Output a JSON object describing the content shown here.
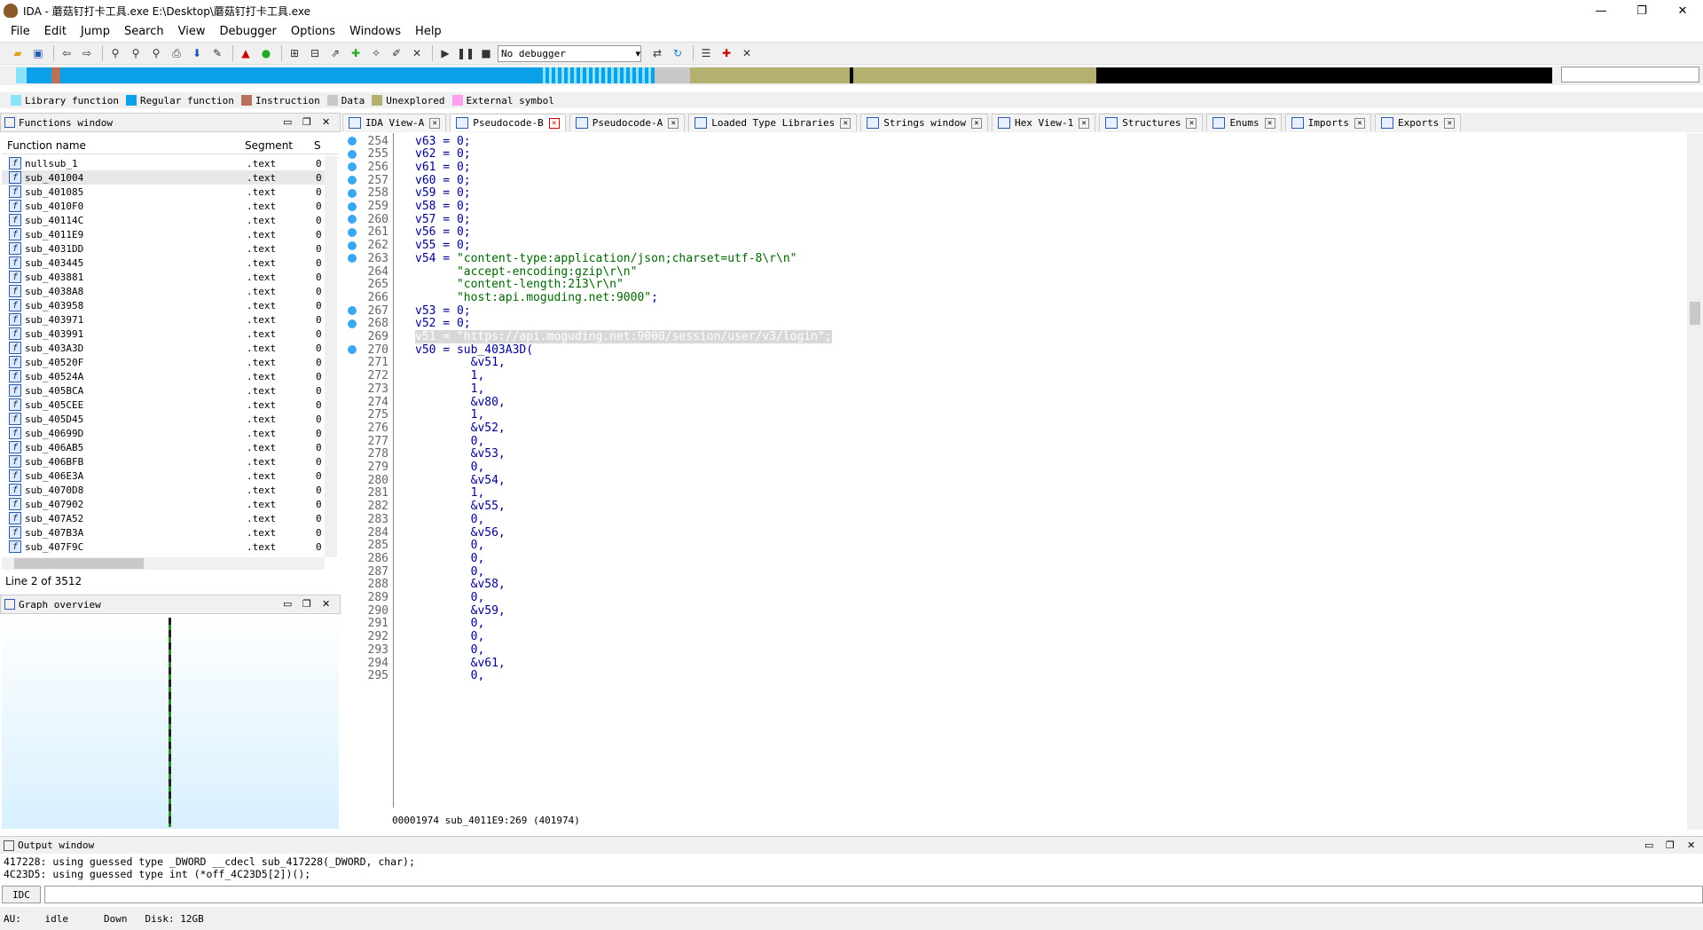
{
  "window": {
    "title": "IDA - 蘑菇钉打卡工具.exe E:\\Desktop\\蘑菇钉打卡工具.exe",
    "minimize": "—",
    "maximize": "❐",
    "close": "✕"
  },
  "menu": [
    "File",
    "Edit",
    "Jump",
    "Search",
    "View",
    "Debugger",
    "Options",
    "Windows",
    "Help"
  ],
  "toolbar": {
    "debugger": "No debugger"
  },
  "legend": [
    {
      "label": "Library function",
      "color": "#8ae3f7"
    },
    {
      "label": "Regular function",
      "color": "#0aa1e8"
    },
    {
      "label": "Instruction",
      "color": "#b8715a"
    },
    {
      "label": "Data",
      "color": "#c8c8c8"
    },
    {
      "label": "Unexplored",
      "color": "#b4b070"
    },
    {
      "label": "External symbol",
      "color": "#ff9ff0"
    }
  ],
  "functions_window": {
    "title": "Functions window",
    "col_name": "Function name",
    "col_segment": "Segment",
    "col_s": "S",
    "rows": [
      {
        "name": "nullsub_1",
        "seg": ".text",
        "s": "0"
      },
      {
        "name": "sub_401004",
        "seg": ".text",
        "s": "0"
      },
      {
        "name": "sub_401085",
        "seg": ".text",
        "s": "0"
      },
      {
        "name": "sub_4010F0",
        "seg": ".text",
        "s": "0"
      },
      {
        "name": "sub_40114C",
        "seg": ".text",
        "s": "0"
      },
      {
        "name": "sub_4011E9",
        "seg": ".text",
        "s": "0"
      },
      {
        "name": "sub_4031DD",
        "seg": ".text",
        "s": "0"
      },
      {
        "name": "sub_403445",
        "seg": ".text",
        "s": "0"
      },
      {
        "name": "sub_403881",
        "seg": ".text",
        "s": "0"
      },
      {
        "name": "sub_4038A8",
        "seg": ".text",
        "s": "0"
      },
      {
        "name": "sub_403958",
        "seg": ".text",
        "s": "0"
      },
      {
        "name": "sub_403971",
        "seg": ".text",
        "s": "0"
      },
      {
        "name": "sub_403991",
        "seg": ".text",
        "s": "0"
      },
      {
        "name": "sub_403A3D",
        "seg": ".text",
        "s": "0"
      },
      {
        "name": "sub_40520F",
        "seg": ".text",
        "s": "0"
      },
      {
        "name": "sub_40524A",
        "seg": ".text",
        "s": "0"
      },
      {
        "name": "sub_405BCA",
        "seg": ".text",
        "s": "0"
      },
      {
        "name": "sub_405CEE",
        "seg": ".text",
        "s": "0"
      },
      {
        "name": "sub_405D45",
        "seg": ".text",
        "s": "0"
      },
      {
        "name": "sub_40699D",
        "seg": ".text",
        "s": "0"
      },
      {
        "name": "sub_406AB5",
        "seg": ".text",
        "s": "0"
      },
      {
        "name": "sub_406BFB",
        "seg": ".text",
        "s": "0"
      },
      {
        "name": "sub_406E3A",
        "seg": ".text",
        "s": "0"
      },
      {
        "name": "sub_4070D8",
        "seg": ".text",
        "s": "0"
      },
      {
        "name": "sub_407902",
        "seg": ".text",
        "s": "0"
      },
      {
        "name": "sub_407A52",
        "seg": ".text",
        "s": "0"
      },
      {
        "name": "sub_407B3A",
        "seg": ".text",
        "s": "0"
      },
      {
        "name": "sub_407F9C",
        "seg": ".text",
        "s": "0"
      }
    ],
    "status": "Line 2 of 3512"
  },
  "graph_overview": {
    "title": "Graph overview"
  },
  "tabs": [
    {
      "label": "IDA View-A"
    },
    {
      "label": "Pseudocode-B",
      "active": true
    },
    {
      "label": "Pseudocode-A"
    },
    {
      "label": "Loaded Type Libraries"
    },
    {
      "label": "Strings window"
    },
    {
      "label": "Hex View-1"
    },
    {
      "label": "Structures"
    },
    {
      "label": "Enums"
    },
    {
      "label": "Imports"
    },
    {
      "label": "Exports"
    }
  ],
  "code": [
    {
      "ln": "254",
      "dot": true,
      "text": "v63 = 0;"
    },
    {
      "ln": "255",
      "dot": true,
      "text": "v62 = 0;"
    },
    {
      "ln": "256",
      "dot": true,
      "text": "v61 = 0;"
    },
    {
      "ln": "257",
      "dot": true,
      "text": "v60 = 0;"
    },
    {
      "ln": "258",
      "dot": true,
      "text": "v59 = 0;"
    },
    {
      "ln": "259",
      "dot": true,
      "text": "v58 = 0;"
    },
    {
      "ln": "260",
      "dot": true,
      "text": "v57 = 0;"
    },
    {
      "ln": "261",
      "dot": true,
      "text": "v56 = 0;"
    },
    {
      "ln": "262",
      "dot": true,
      "text": "v55 = 0;"
    },
    {
      "ln": "263",
      "dot": true,
      "text": "v54 = \"content-type:application/json;charset=utf-8\\r\\n\""
    },
    {
      "ln": "264",
      "dot": false,
      "text": "      \"accept-encoding:gzip\\r\\n\""
    },
    {
      "ln": "265",
      "dot": false,
      "text": "      \"content-length:213\\r\\n\""
    },
    {
      "ln": "266",
      "dot": false,
      "text": "      \"host:api.moguding.net:9000\";"
    },
    {
      "ln": "267",
      "dot": true,
      "text": "v53 = 0;"
    },
    {
      "ln": "268",
      "dot": true,
      "text": "v52 = 0;"
    },
    {
      "ln": "269",
      "dot": false,
      "hl": true,
      "text": "v51 = \"https://api.moguding.net:9000/session/user/v3/login\";"
    },
    {
      "ln": "270",
      "dot": true,
      "text": "v50 = sub_403A3D("
    },
    {
      "ln": "271",
      "dot": false,
      "text": "        &v51,"
    },
    {
      "ln": "272",
      "dot": false,
      "text": "        1,"
    },
    {
      "ln": "273",
      "dot": false,
      "text": "        1,"
    },
    {
      "ln": "274",
      "dot": false,
      "text": "        &v80,"
    },
    {
      "ln": "275",
      "dot": false,
      "text": "        1,"
    },
    {
      "ln": "276",
      "dot": false,
      "text": "        &v52,"
    },
    {
      "ln": "277",
      "dot": false,
      "text": "        0,"
    },
    {
      "ln": "278",
      "dot": false,
      "text": "        &v53,"
    },
    {
      "ln": "279",
      "dot": false,
      "text": "        0,"
    },
    {
      "ln": "280",
      "dot": false,
      "text": "        &v54,"
    },
    {
      "ln": "281",
      "dot": false,
      "text": "        1,"
    },
    {
      "ln": "282",
      "dot": false,
      "text": "        &v55,"
    },
    {
      "ln": "283",
      "dot": false,
      "text": "        0,"
    },
    {
      "ln": "284",
      "dot": false,
      "text": "        &v56,"
    },
    {
      "ln": "285",
      "dot": false,
      "text": "        0,"
    },
    {
      "ln": "286",
      "dot": false,
      "text": "        0,"
    },
    {
      "ln": "287",
      "dot": false,
      "text": "        0,"
    },
    {
      "ln": "288",
      "dot": false,
      "text": "        &v58,"
    },
    {
      "ln": "289",
      "dot": false,
      "text": "        0,"
    },
    {
      "ln": "290",
      "dot": false,
      "text": "        &v59,"
    },
    {
      "ln": "291",
      "dot": false,
      "text": "        0,"
    },
    {
      "ln": "292",
      "dot": false,
      "text": "        0,"
    },
    {
      "ln": "293",
      "dot": false,
      "text": "        0,"
    },
    {
      "ln": "294",
      "dot": false,
      "text": "        &v61,"
    },
    {
      "ln": "295",
      "dot": false,
      "text": "        0,"
    }
  ],
  "code_status": "00001974 sub_4011E9:269 (401974)",
  "output": {
    "title": "Output window",
    "lines": [
      "417228: using guessed type _DWORD __cdecl sub_417228(_DWORD, char);",
      "4C23D5: using guessed type int (*off_4C23D5[2])();"
    ],
    "idc_label": "IDC"
  },
  "statusbar": {
    "au": "AU:",
    "au_state": "idle",
    "direction": "Down",
    "disk": "Disk: 12GB"
  }
}
